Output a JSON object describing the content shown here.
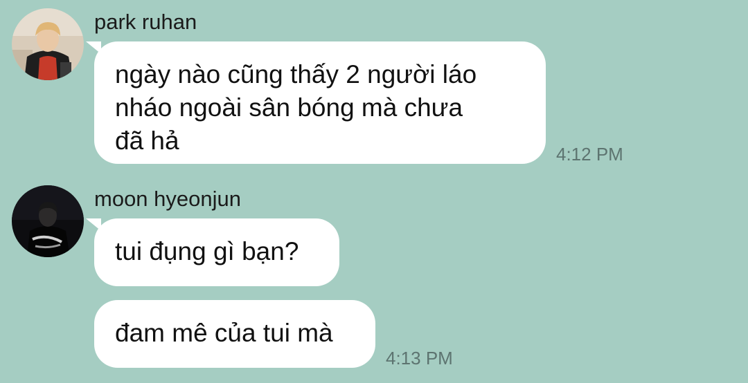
{
  "messages": [
    {
      "sender": "park ruhan",
      "avatar_icon": "user-avatar-photo-light",
      "bubbles": [
        {
          "lines": [
            "ngày nào cũng thấy 2 người láo",
            "nháo ngoài sân bóng mà chưa",
            "đã hả"
          ]
        }
      ],
      "time": "4:12 PM"
    },
    {
      "sender": "moon hyeonjun",
      "avatar_icon": "user-avatar-photo-dark",
      "bubbles": [
        {
          "lines": [
            "tui đụng gì bạn?"
          ]
        },
        {
          "lines": [
            "đam mê của tui mà"
          ]
        }
      ],
      "time": "4:13 PM"
    }
  ],
  "colors": {
    "background": "#a5cdc2",
    "bubble": "#ffffff",
    "timestamp": "#5d7470"
  }
}
